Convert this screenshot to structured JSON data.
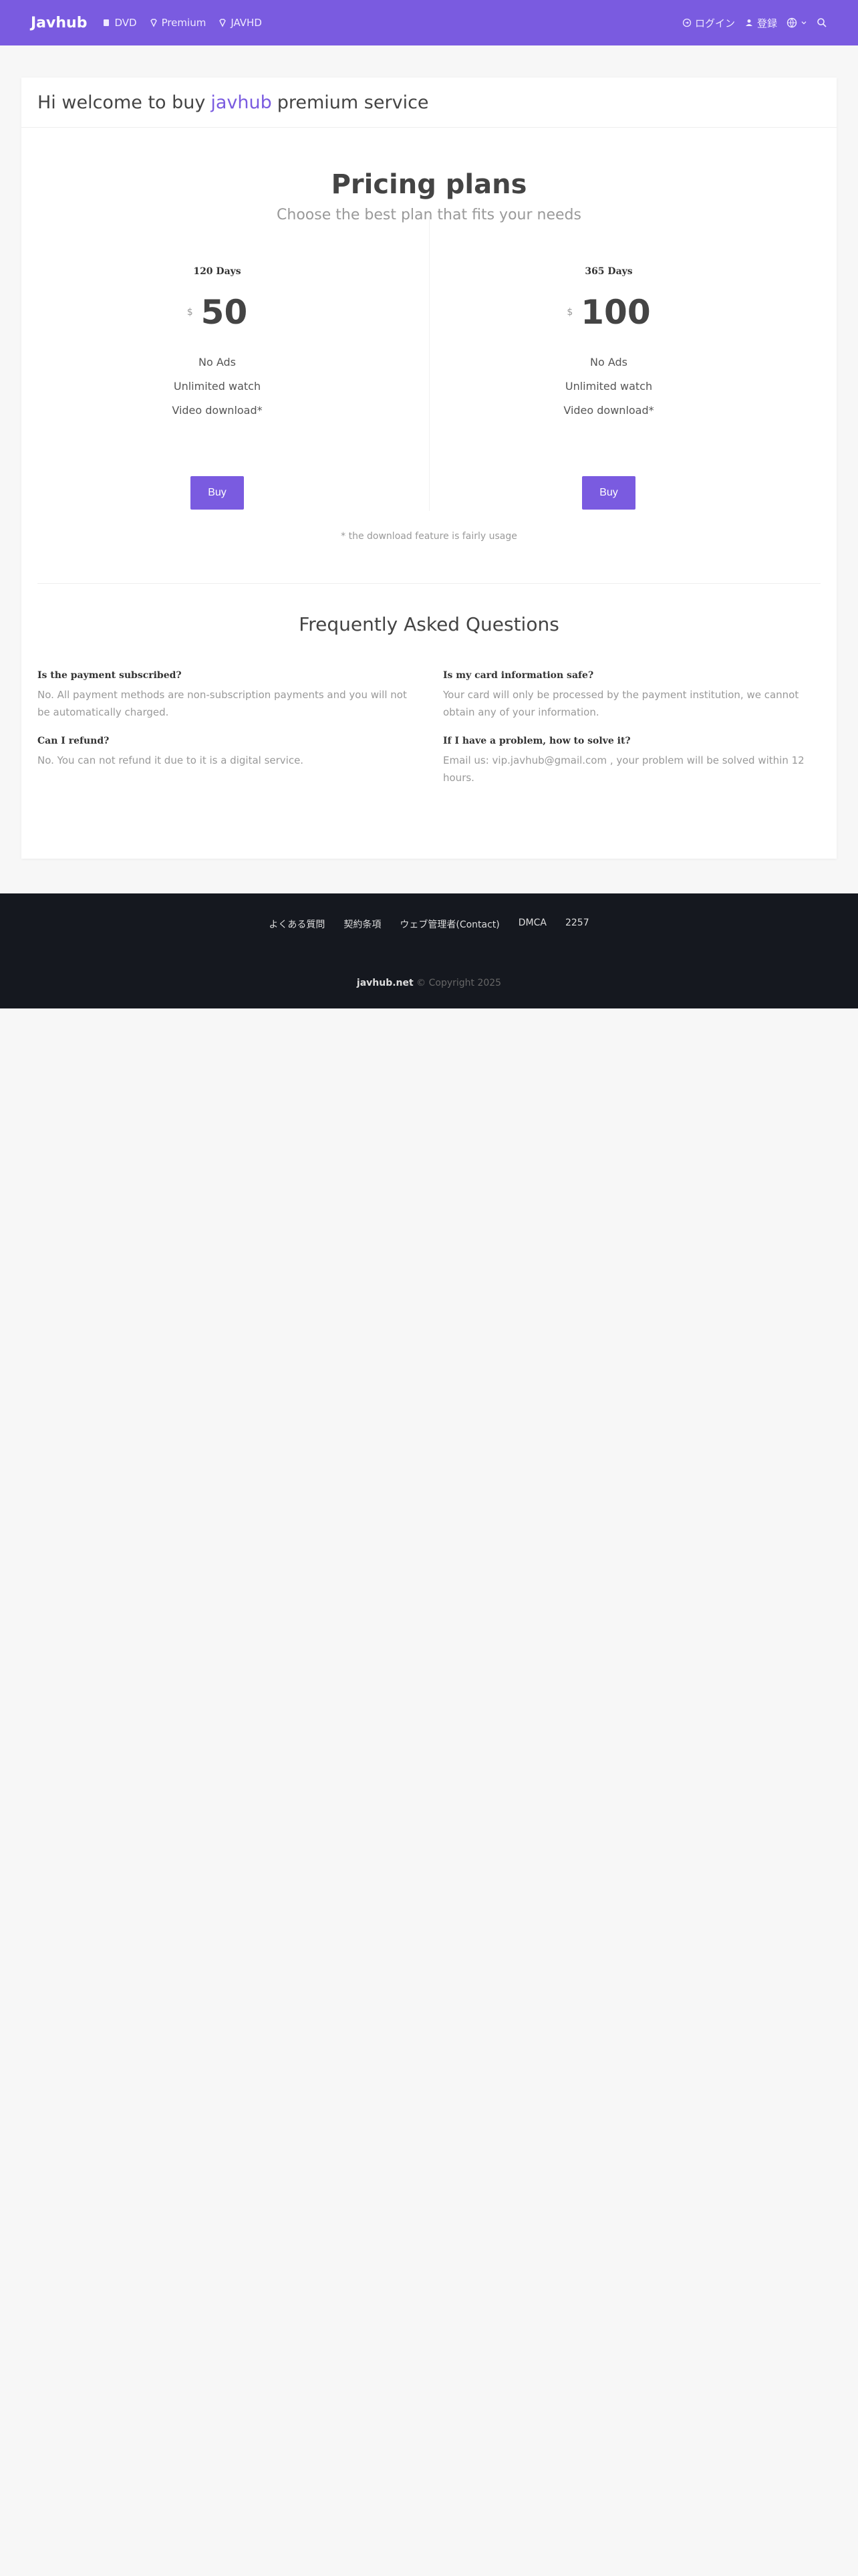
{
  "navbar": {
    "brand": "Javhub",
    "links": [
      {
        "label": "DVD",
        "icon": "dvd-icon"
      },
      {
        "label": "Premium",
        "icon": "diamond-icon"
      },
      {
        "label": "JAVHD",
        "icon": "diamond-icon"
      }
    ],
    "login": "ログイン",
    "register": "登録"
  },
  "welcome": {
    "prefix": "Hi welcome to buy",
    "brand": "javhub",
    "suffix": "premium service"
  },
  "pricing": {
    "title": "Pricing plans",
    "subtitle": "Choose the best plan that fits your needs",
    "plans": [
      {
        "days": "120 Days",
        "currency": "$",
        "price": "50",
        "features": [
          "No Ads",
          "Unlimited watch",
          "Video download*"
        ],
        "buy_label": "Buy"
      },
      {
        "days": "365 Days",
        "currency": "$",
        "price": "100",
        "features": [
          "No Ads",
          "Unlimited watch",
          "Video download*"
        ],
        "buy_label": "Buy"
      }
    ],
    "note": "* the download feature is fairly usage"
  },
  "faq": {
    "title": "Frequently Asked Questions",
    "items": [
      {
        "q": "Is the payment subscribed?",
        "a": "No. All payment methods are non-subscription payments and you will not be automatically charged."
      },
      {
        "q": "Is my card information safe?",
        "a": "Your card will only be processed by the payment institution, we cannot obtain any of your information."
      },
      {
        "q": "Can I refund?",
        "a": "No. You can not refund it due to it is a digital service."
      },
      {
        "q": "If I have a problem, how to solve it?",
        "a": "Email us: vip.javhub@gmail.com , your problem will be solved within 12 hours."
      }
    ]
  },
  "footer": {
    "links": [
      "よくある質問",
      "契約条項",
      "ウェブ管理者(Contact)",
      "DMCA",
      "2257"
    ],
    "site": "javhub.net",
    "copyright": "© Copyright 2025"
  },
  "colors": {
    "accent": "#7a5be0",
    "footer_bg": "#15181f"
  }
}
